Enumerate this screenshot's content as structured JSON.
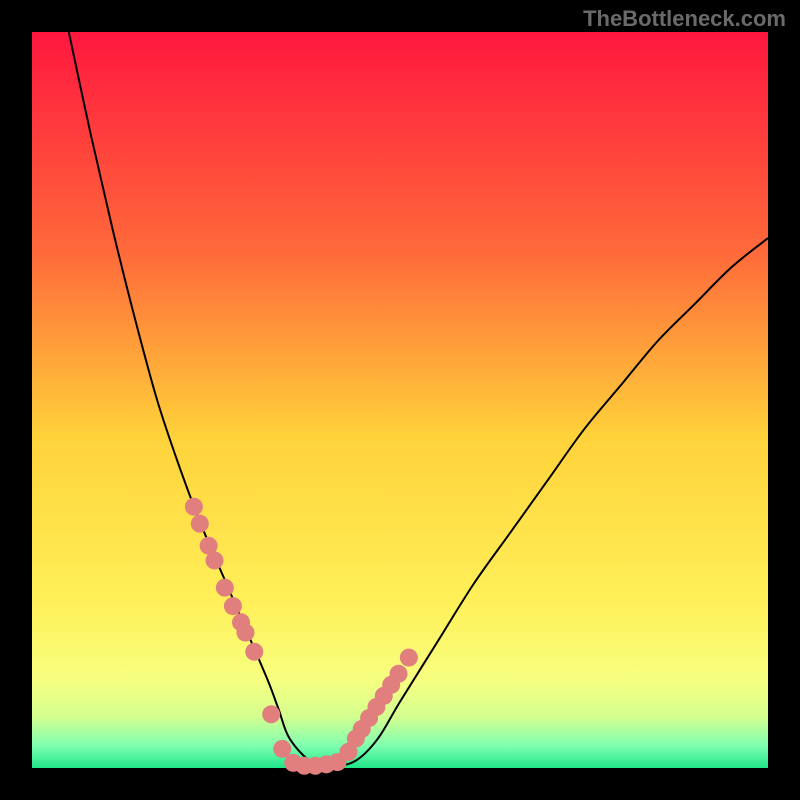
{
  "watermark": "TheBottleneck.com",
  "chart_data": {
    "type": "line",
    "title": "",
    "xlabel": "",
    "ylabel": "",
    "xlim": [
      0,
      100
    ],
    "ylim": [
      0,
      100
    ],
    "grid": false,
    "legend": false,
    "background_gradient": {
      "stops": [
        {
          "pos": 0.0,
          "color": "#ff173f"
        },
        {
          "pos": 0.3,
          "color": "#ff6a3a"
        },
        {
          "pos": 0.55,
          "color": "#ffd23a"
        },
        {
          "pos": 0.78,
          "color": "#fff15a"
        },
        {
          "pos": 0.88,
          "color": "#f7ff80"
        },
        {
          "pos": 0.93,
          "color": "#d4ff8f"
        },
        {
          "pos": 0.97,
          "color": "#7fffb0"
        },
        {
          "pos": 1.0,
          "color": "#20e68a"
        }
      ]
    },
    "series": [
      {
        "name": "curve",
        "color": "#000000",
        "width": 2,
        "x": [
          5,
          8,
          11,
          14,
          17,
          20,
          23,
          26,
          29,
          32,
          33.5,
          35,
          38,
          41,
          44,
          47,
          50,
          55,
          60,
          65,
          70,
          75,
          80,
          85,
          90,
          95,
          100
        ],
        "y": [
          100,
          86,
          73,
          61,
          50,
          41,
          33,
          26,
          19,
          12,
          8,
          4,
          0.8,
          0.3,
          1.0,
          4,
          9,
          17,
          25,
          32,
          39,
          46,
          52,
          58,
          63,
          68,
          72
        ]
      },
      {
        "name": "dot-overlay",
        "type": "scatter",
        "color": "#e07f7e",
        "radius": 9,
        "x": [
          22.0,
          22.8,
          24.0,
          24.8,
          26.2,
          27.3,
          28.4,
          29.0,
          30.2,
          32.5,
          34.0,
          35.5,
          37.0,
          38.5,
          40.0,
          41.5,
          43.0,
          44.0,
          44.8,
          45.8,
          46.8,
          47.8,
          48.8,
          49.8,
          51.2
        ],
        "y": [
          35.5,
          33.2,
          30.2,
          28.2,
          24.5,
          22.0,
          19.8,
          18.4,
          15.8,
          7.3,
          2.6,
          0.7,
          0.3,
          0.3,
          0.5,
          0.8,
          2.2,
          4.0,
          5.3,
          6.8,
          8.3,
          9.8,
          11.3,
          12.8,
          15.0
        ]
      }
    ]
  }
}
